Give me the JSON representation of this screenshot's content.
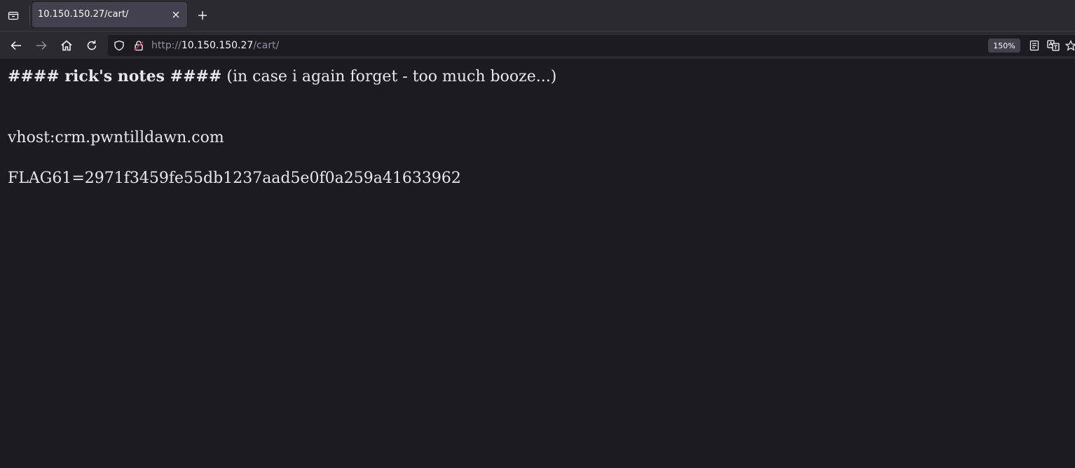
{
  "browser": {
    "tab": {
      "title": "10.150.150.27/cart/"
    },
    "url": {
      "scheme": "http://",
      "host": "10.150.150.27",
      "path": "/cart/"
    },
    "zoom": "150%"
  },
  "icons": {
    "tab_list": "tab-list-icon",
    "tab_close": "close-icon",
    "new_tab": "plus-icon",
    "back": "arrow-left-icon",
    "forward": "arrow-right-icon",
    "home": "home-icon",
    "reload": "reload-icon",
    "tracking": "shield-icon",
    "insecure": "lock-insecure-icon",
    "reader": "reader-view-icon",
    "translate": "translate-icon",
    "bookmark": "star-icon"
  },
  "page": {
    "heading_bold": "#### rick's notes ####",
    "heading_rest": " (in case i again forget - too much booze...)",
    "vhost": "vhost:crm.pwntilldawn.com",
    "flag": "FLAG61=2971f3459fe55db1237aad5e0f0a259a41633962"
  },
  "colors": {
    "chrome_bg": "#2b2a33",
    "tab_active": "#42414d",
    "page_bg": "#1c1b22",
    "text": "#fbfbfe",
    "insecure_lock": "#e22850"
  }
}
